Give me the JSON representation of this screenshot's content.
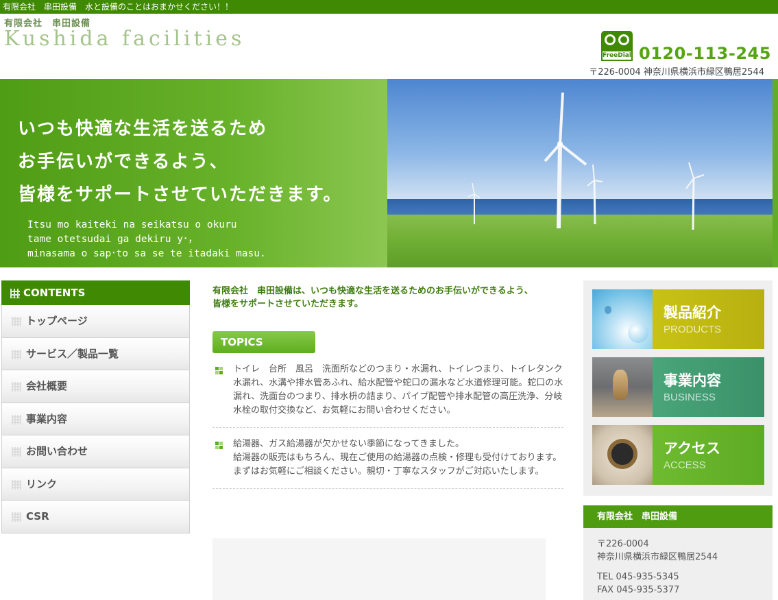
{
  "topbar": {
    "text": "有限会社　串田設備　水と設備のことはおまかせください！！"
  },
  "header": {
    "logo_sub": "有限会社　串田設備",
    "logo_main": "Kushida facilities",
    "freedial_label": "FreeDial",
    "phone": "0120-113-245",
    "address": "〒226-0004 神奈川県横浜市緑区鴨居2544"
  },
  "hero": {
    "line1": "いつも快適な生活を送るため",
    "line2": "お手伝いができるよう、",
    "line3": "皆様をサポートさせていただきます。",
    "roman1": "Itsu mo kaiteki na seikatsu o okuru",
    "roman2": "tame otetsudai ga dekiru y･，",
    "roman3": "minasama o sap･to sa se te itadaki masu."
  },
  "sidebar": {
    "heading": "CONTENTS",
    "items": [
      {
        "label": "トップページ"
      },
      {
        "label": "サービス／製品一覧"
      },
      {
        "label": "会社概要"
      },
      {
        "label": "事業内容"
      },
      {
        "label": "お問い合わせ"
      },
      {
        "label": "リンク"
      },
      {
        "label": "CSR"
      }
    ]
  },
  "main": {
    "intro_line1": "有限会社　串田設備は、いつも快適な生活を送るためのお手伝いができるよう、",
    "intro_line2": "皆様をサポートさせていただきます。",
    "topics_label": "TOPICS",
    "topics": [
      {
        "text": "トイレ　台所　風呂　洗面所などのつまり・水漏れ、トイレつまり、トイレタンク水漏れ、水溝や排水管あふれ、給水配管や蛇口の漏水など水道修理可能。蛇口の水漏れ、洗面台のつまり、排水枡の詰まり、パイプ配管や排水配管の高圧洗浄、分岐水栓の取付交換など、お気軽にお問い合わせください。"
      },
      {
        "line1": "給湯器、ガス給湯器が欠かせない季節になってきました。",
        "line2": "給湯器の販売はもちろん、現在ご使用の給湯器の点検・修理も受付けております。まずはお気軽にご相談ください。親切・丁寧なスタッフがご対応いたします。"
      }
    ]
  },
  "right": {
    "banners": [
      {
        "jp": "製品紹介",
        "en": "PRODUCTS",
        "color": "#c4bd14"
      },
      {
        "jp": "事業内容",
        "en": "BUSINESS",
        "color": "#3f9d72"
      },
      {
        "jp": "アクセス",
        "en": "ACCESS",
        "color": "#69b62c"
      }
    ],
    "company": {
      "heading": "有限会社　串田設備",
      "postal": "〒226-0004",
      "address": "神奈川県横浜市緑区鴨居2544",
      "tel": "TEL 045-935-5345",
      "fax": "FAX 045-935-5377"
    }
  }
}
